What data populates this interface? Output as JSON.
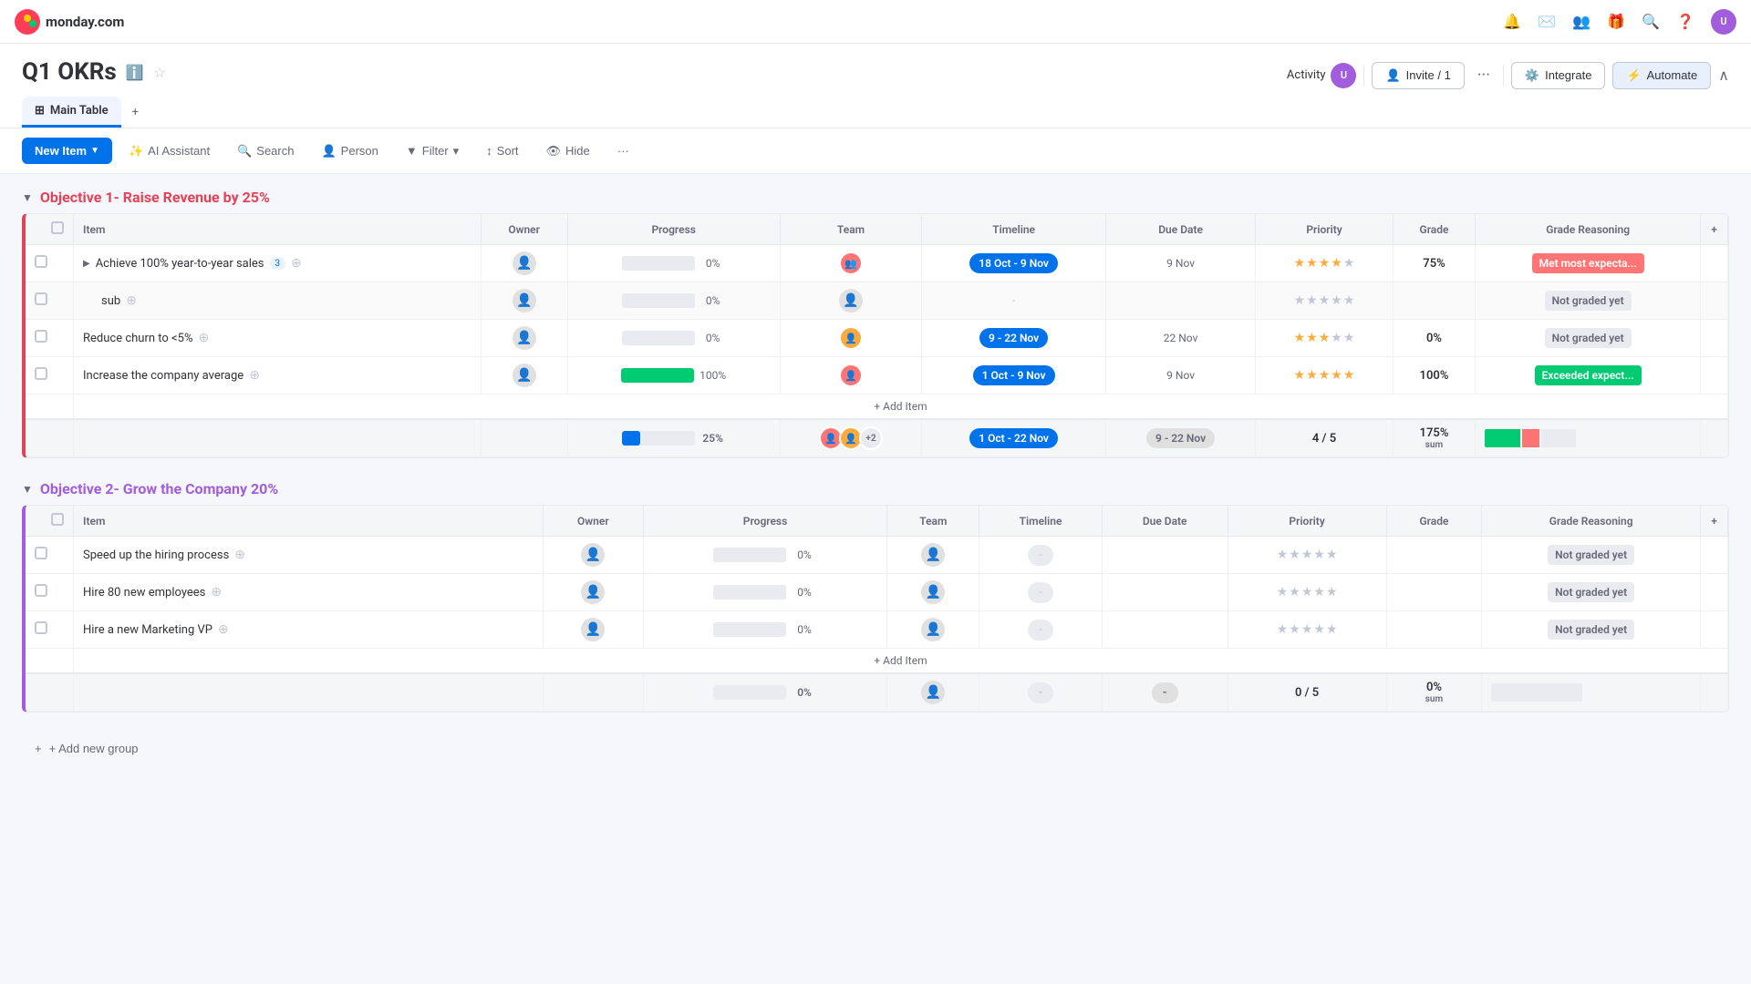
{
  "app": {
    "name": "monday.com"
  },
  "nav": {
    "icons": [
      "🔔",
      "✉",
      "👤",
      "🎁",
      "🔍",
      "?",
      "👤"
    ]
  },
  "header": {
    "title": "Q1 OKRs",
    "info_icon": "ℹ",
    "star_icon": "☆",
    "activity_label": "Activity",
    "invite_label": "Invite / 1",
    "integrate_label": "Integrate",
    "automate_label": "Automate",
    "more_icon": "···",
    "collapse_icon": "∧"
  },
  "tabs": [
    {
      "label": "Main Table",
      "active": true
    },
    {
      "label": "+",
      "add": true
    }
  ],
  "toolbar": {
    "new_item_label": "New Item",
    "ai_assistant_label": "AI Assistant",
    "search_label": "Search",
    "person_label": "Person",
    "filter_label": "Filter",
    "sort_label": "Sort",
    "hide_label": "Hide",
    "more_label": "···"
  },
  "objective1": {
    "title": "Objective 1- Raise Revenue by 25%",
    "color": "#e44258",
    "columns": [
      "Item",
      "Owner",
      "Progress",
      "Team",
      "Timeline",
      "Due Date",
      "Priority",
      "Grade",
      "Grade Reasoning"
    ],
    "rows": [
      {
        "item": "Achieve 100% year-to-year sales",
        "sub_count": "3",
        "has_expand": true,
        "owner": "",
        "progress": 0,
        "progress_label": "0%",
        "team": "group",
        "team_type": "colored-1",
        "timeline": "18 Oct - 9 Nov",
        "timeline_color": "#0073ea",
        "due_date": "9 Nov",
        "stars": 4,
        "grade": "75%",
        "grade_reasoning": "Met most expecta...",
        "grade_color": "orange"
      },
      {
        "item": "sub",
        "has_expand": false,
        "owner": "",
        "progress": 0,
        "progress_label": "0%",
        "team": "",
        "timeline": "-",
        "due_date": "",
        "stars": 0,
        "grade": "",
        "grade_reasoning": "Not graded yet",
        "grade_color": "gray"
      },
      {
        "item": "Reduce churn to <5%",
        "has_expand": false,
        "owner": "",
        "progress": 0,
        "progress_label": "0%",
        "team": "single",
        "team_type": "colored-2",
        "timeline": "9 - 22 Nov",
        "timeline_color": "#0073ea",
        "due_date": "22 Nov",
        "stars": 3,
        "grade": "0%",
        "grade_reasoning": "Not graded yet",
        "grade_color": "gray"
      },
      {
        "item": "Increase the company average",
        "has_expand": false,
        "owner": "",
        "progress": 100,
        "progress_label": "100%",
        "team": "single",
        "team_type": "colored-1",
        "timeline": "1 Oct - 9 Nov",
        "timeline_color": "#0073ea",
        "due_date": "9 Nov",
        "stars": 5,
        "grade": "100%",
        "grade_reasoning": "Exceeded expect...",
        "grade_color": "green"
      }
    ],
    "summary": {
      "progress": 25,
      "progress_label": "25%",
      "team_plus": "+2",
      "timeline": "1 Oct - 22 Nov",
      "due_date": "9 - 22 Nov",
      "priority": "4 / 5",
      "grade": "175%",
      "grade_sum": "sum"
    },
    "add_item": "+ Add Item"
  },
  "objective2": {
    "title": "Objective 2- Grow the Company 20%",
    "color": "#a25ddc",
    "columns": [
      "Item",
      "Owner",
      "Progress",
      "Team",
      "Timeline",
      "Due Date",
      "Priority",
      "Grade",
      "Grade Reasoning"
    ],
    "rows": [
      {
        "item": "Speed up the hiring process",
        "has_expand": false,
        "owner": "",
        "progress": 0,
        "progress_label": "0%",
        "team": "",
        "timeline": "-",
        "due_date": "",
        "stars": 0,
        "grade": "",
        "grade_reasoning": "Not graded yet",
        "grade_color": "gray"
      },
      {
        "item": "Hire 80 new employees",
        "has_expand": false,
        "owner": "",
        "progress": 0,
        "progress_label": "0%",
        "team": "",
        "timeline": "-",
        "due_date": "",
        "stars": 0,
        "grade": "",
        "grade_reasoning": "Not graded yet",
        "grade_color": "gray"
      },
      {
        "item": "Hire a new Marketing VP",
        "has_expand": false,
        "owner": "",
        "progress": 0,
        "progress_label": "0%",
        "team": "",
        "timeline": "-",
        "due_date": "",
        "stars": 0,
        "grade": "",
        "grade_reasoning": "Not graded yet",
        "grade_color": "gray"
      }
    ],
    "summary": {
      "progress": 0,
      "progress_label": "0%",
      "team_plus": "",
      "timeline": "-",
      "due_date": "-",
      "priority": "0 / 5",
      "grade": "0%",
      "grade_sum": "sum"
    },
    "add_item": "+ Add Item"
  },
  "add_group": "+ Add new group"
}
